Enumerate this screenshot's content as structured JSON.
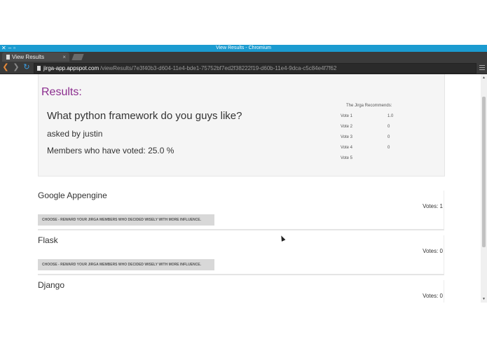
{
  "window": {
    "title": "View Results - Chromium"
  },
  "tab": {
    "title": "View Results"
  },
  "address": {
    "host": "jirga-app.appspot.com",
    "path": "/viewResults/7e3f40b3-d604-11e4-bde1-75752bf7ed2f38222f19-d60b-11e4-9dca-c5c84e4f7f62"
  },
  "results": {
    "heading": "Results:",
    "question": "What python framework do you guys like?",
    "asked_by": "asked by justin",
    "members_voted": "Members who have voted: 25.0 %"
  },
  "recommend": {
    "title": "The Jirga Recommends:",
    "votes": [
      {
        "label": "Vote 1",
        "value": "1.0"
      },
      {
        "label": "Vote 2",
        "value": "0"
      },
      {
        "label": "Vote 3",
        "value": "0"
      },
      {
        "label": "Vote 4",
        "value": "0"
      },
      {
        "label": "Vote 5",
        "value": ""
      }
    ]
  },
  "options": [
    {
      "name": "Google Appengine",
      "votes": "Votes: 1",
      "button": "CHOOSE - REWARD YOUR JIRGA MEMBERS WHO DECIDED WISELY WITH MORE INFLUENCE."
    },
    {
      "name": "Flask",
      "votes": "Votes: 0",
      "button": "CHOOSE - REWARD YOUR JIRGA MEMBERS WHO DECIDED WISELY WITH MORE INFLUENCE."
    },
    {
      "name": "Django",
      "votes": "Votes: 0"
    }
  ],
  "colors": {
    "accent": "#8b2d8e",
    "titlebar": "#1b9bd0",
    "chrome_bg": "#3a3a3a"
  },
  "icons": [
    "close-icon",
    "minimize-icon",
    "maximize-icon",
    "page-icon",
    "back-icon",
    "forward-icon",
    "reload-icon",
    "menu-icon"
  ]
}
